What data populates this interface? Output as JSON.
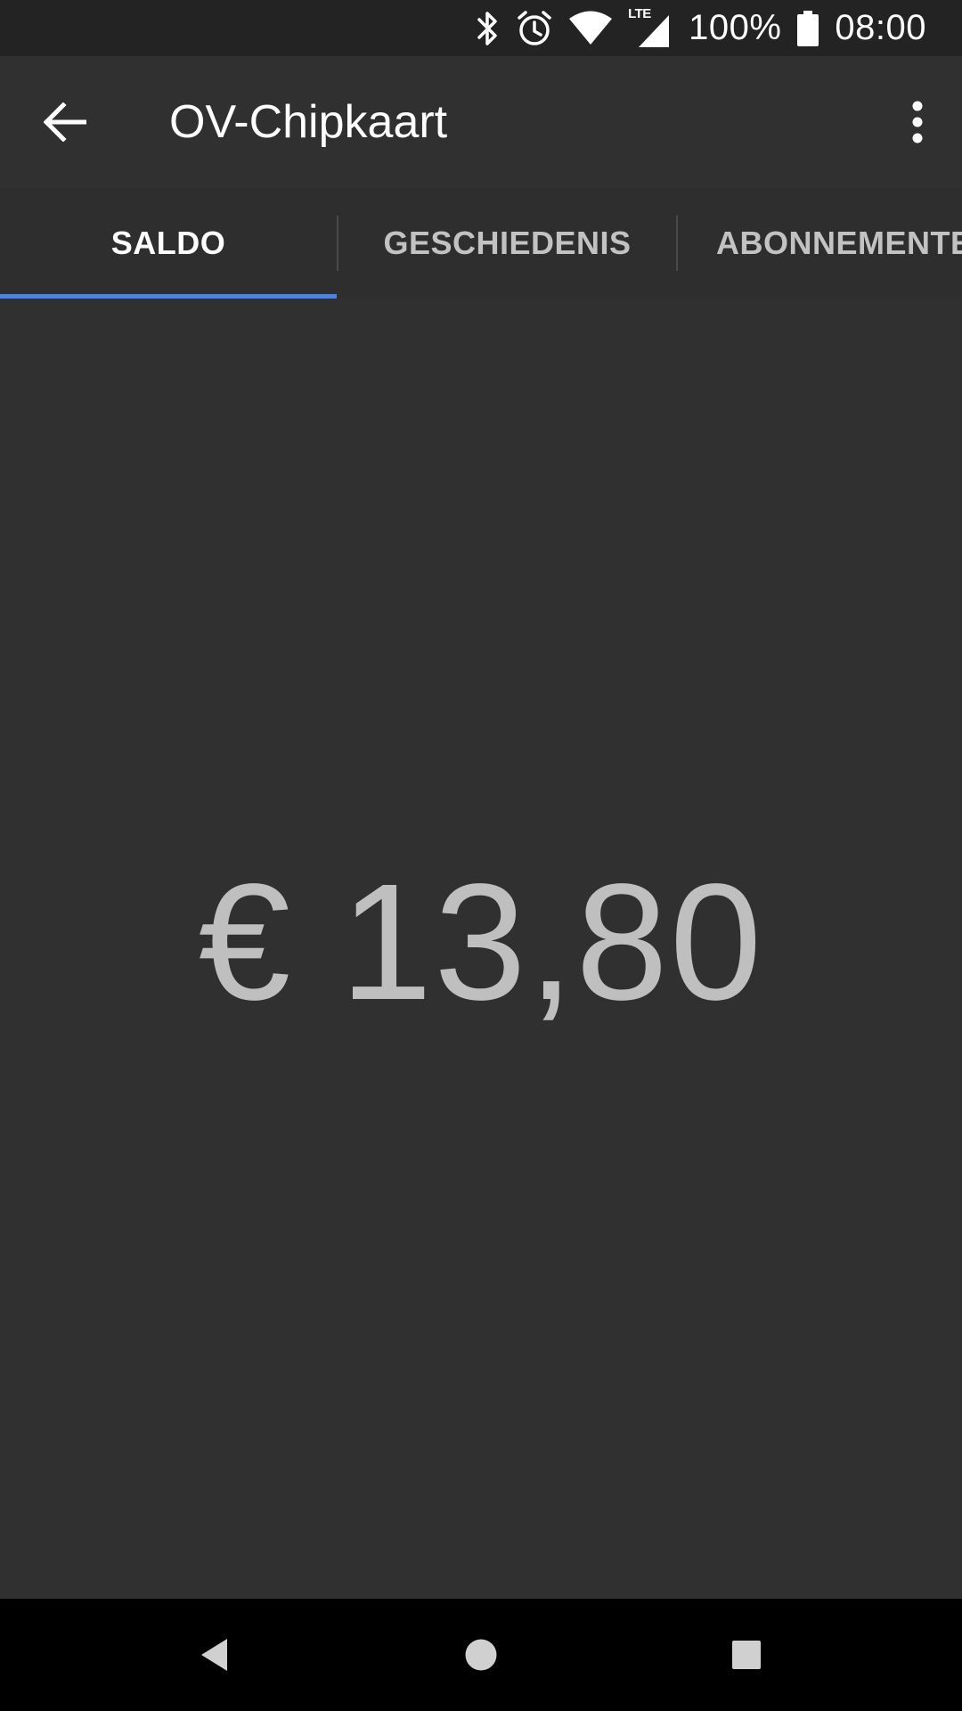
{
  "status_bar": {
    "battery_text": "100%",
    "time": "08:00",
    "network_label": "LTE",
    "icons": [
      "bluetooth-icon",
      "alarm-icon",
      "wifi-icon",
      "lte-signal-icon",
      "battery-icon"
    ]
  },
  "app_bar": {
    "title": "OV-Chipkaart",
    "back_icon": "arrow-back-icon",
    "menu_icon": "more-vert-icon"
  },
  "tabs": [
    {
      "label": "SALDO",
      "selected": true
    },
    {
      "label": "GESCHIEDENIS",
      "selected": false
    },
    {
      "label": "ABONNEMENTEN",
      "selected": false
    }
  ],
  "balance": {
    "amount": "€ 13,80"
  },
  "nav_bar": {
    "icons": [
      "nav-back-icon",
      "nav-home-icon",
      "nav-recents-icon"
    ]
  },
  "colors": {
    "background": "#303030",
    "status_bar": "#232323",
    "tab_indicator": "#4f82db",
    "balance_text": "#bfbfbf",
    "nav_bar": "#000000"
  }
}
